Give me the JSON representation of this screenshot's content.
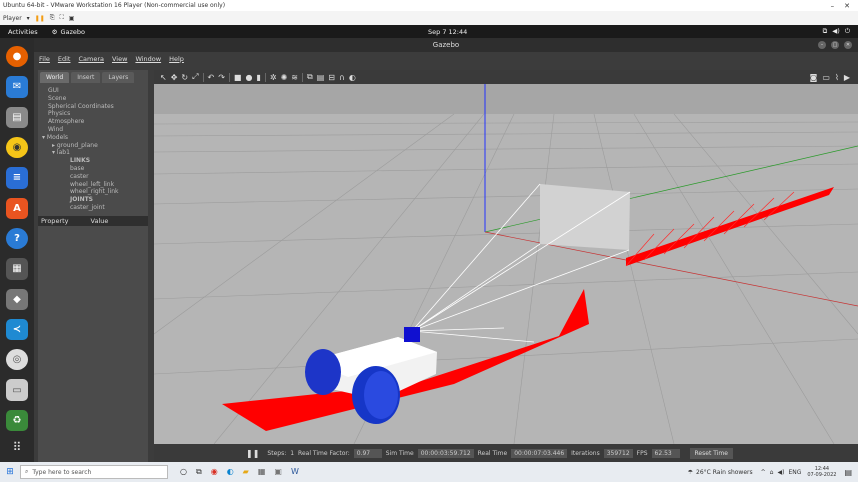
{
  "vm": {
    "title": "Ubuntu 64-bit - VMware Workstation 16 Player (Non-commercial use only)",
    "player_label": "Player"
  },
  "ubuntu": {
    "activities": "Activities",
    "app_name": "Gazebo",
    "clock": "Sep 7  12:44"
  },
  "gazebo": {
    "title": "Gazebo",
    "menu": [
      "File",
      "Edit",
      "Camera",
      "View",
      "Window",
      "Help"
    ],
    "tabs": [
      "World",
      "Insert",
      "Layers"
    ],
    "tree": {
      "gui": "GUI",
      "scene": "Scene",
      "spherical": "Spherical Coordinates",
      "physics": "Physics",
      "atmosphere": "Atmosphere",
      "wind": "Wind",
      "models": "Models",
      "ground_plane": "ground_plane",
      "lab": "lab1",
      "links_header": "LINKS",
      "link_base": "base",
      "link_caster": "caster",
      "link_wl": "wheel_left_link",
      "link_wr": "wheel_right_link",
      "joints_header": "JOINTS",
      "joint_caster": "caster_joint"
    },
    "props": {
      "property": "Property",
      "value": "Value"
    },
    "status": {
      "steps_label": "Steps:",
      "steps_val": "1",
      "rtf_label": "Real Time Factor:",
      "rtf_val": "0.97",
      "sim_label": "Sim Time",
      "sim_val": "00:00:03:59.712",
      "real_label": "Real Time",
      "real_val": "00:00:07:03.446",
      "iter_label": "Iterations",
      "iter_val": "359712",
      "fps_label": "FPS",
      "fps_val": "62.53",
      "reset": "Reset Time"
    }
  },
  "taskbar": {
    "search_placeholder": "Type here to search",
    "weather": "26°C  Rain showers",
    "lang": "ENG",
    "time": "12:44",
    "date": "07-09-2022"
  }
}
